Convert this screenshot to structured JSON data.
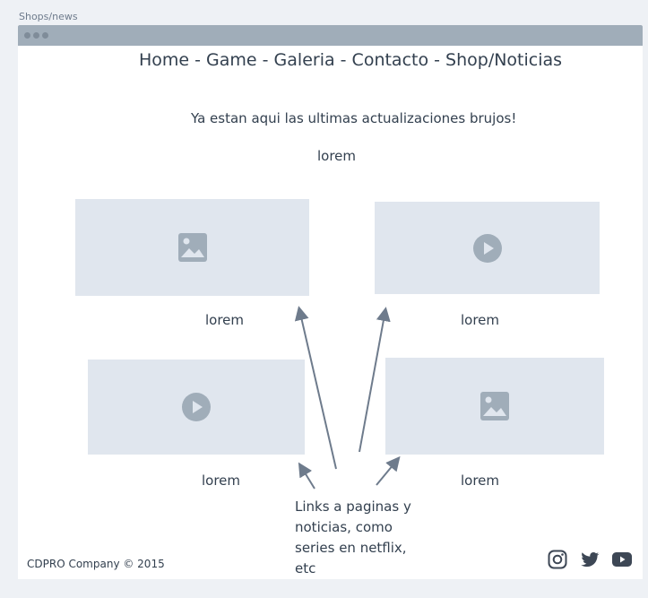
{
  "page": {
    "label": "Shops/news"
  },
  "nav": {
    "text": "Home - Game - Galeria - Contacto - Shop/Noticias"
  },
  "main": {
    "subtitle": "Ya estan aqui las ultimas actualizaciones brujos!",
    "intro": "lorem"
  },
  "media": [
    {
      "kind": "image-icon",
      "caption": "lorem"
    },
    {
      "kind": "play-icon",
      "caption": "lorem"
    },
    {
      "kind": "play-icon",
      "caption": "lorem"
    },
    {
      "kind": "image-icon",
      "caption": "lorem"
    }
  ],
  "annotation": {
    "text": "Links a paginas y noticias, como series en netflix, etc"
  },
  "footer": {
    "copyright": "CDPRO Company © 2015",
    "social": [
      "instagram-icon",
      "twitter-icon",
      "youtube-icon"
    ]
  },
  "colors": {
    "background": "#eef1f5",
    "placeholder": "#e0e6ee",
    "icon": "#a0adb9",
    "text": "#33404f",
    "arrow": "#6e7b8c"
  }
}
